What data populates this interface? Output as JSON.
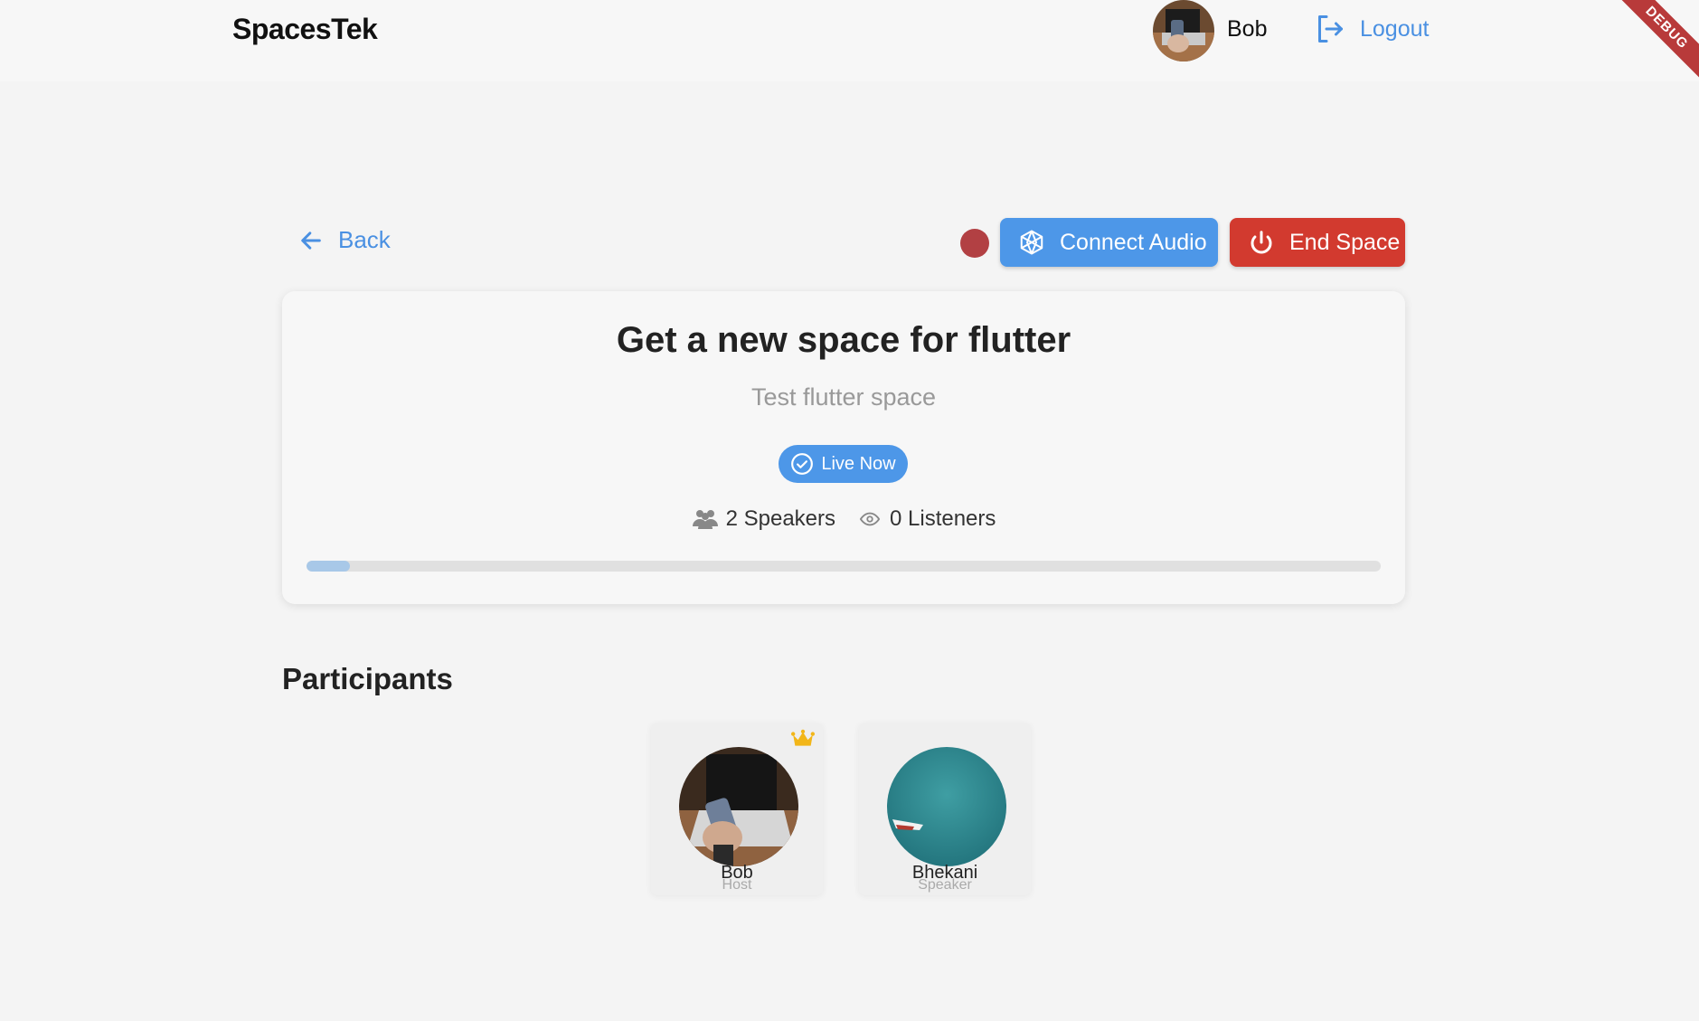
{
  "app": {
    "brand": "SpacesTek",
    "debug_label": "DEBUG"
  },
  "header": {
    "user_name": "Bob",
    "logout_label": "Logout"
  },
  "actions": {
    "back_label": "Back",
    "connect_label": "Connect Audio",
    "end_label": "End Space"
  },
  "space": {
    "title": "Get a new space for flutter",
    "subtitle": "Test flutter space",
    "status": "Live Now",
    "speakers": "2 Speakers",
    "listeners": "0 Listeners",
    "progress": 0.04
  },
  "participants": {
    "heading": "Participants",
    "items": [
      {
        "name": "Bob",
        "role": "Host"
      },
      {
        "name": "Bhekani",
        "role": "Speaker"
      }
    ]
  },
  "colors": {
    "accent": "#4d97e8",
    "danger": "#d23a2f",
    "record": "#b24043"
  }
}
